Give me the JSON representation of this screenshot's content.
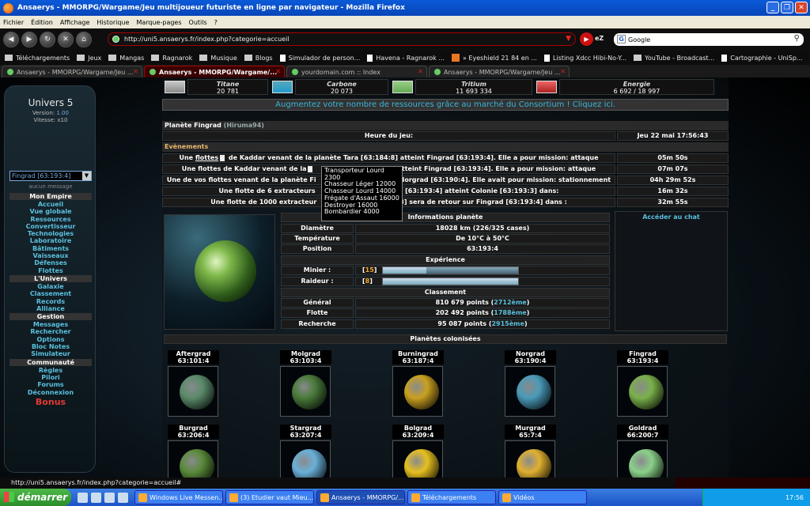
{
  "window": {
    "title": "Ansaerys - MMORPG/Wargame/Jeu multijoueur futuriste en ligne par navigateur - Mozilla Firefox"
  },
  "menu": [
    "Fichier",
    "Édition",
    "Affichage",
    "Historique",
    "Marque-pages",
    "Outils",
    "?"
  ],
  "url": "http://uni5.ansaerys.fr/index.php?categorie=accueil",
  "search": {
    "engine": "Google"
  },
  "bookmarks": [
    "Téléchargements",
    "Jeux",
    "Mangas",
    "Ragnarok",
    "Musique",
    "Blogs",
    "Simulador de person...",
    "Havena - Ragnarok ...",
    "» Eyeshield 21 84 en ...",
    "Listing Xdcc Hibi-No-Y...",
    "YouTube - Broadcast...",
    "Cartographie - UniSp..."
  ],
  "tabs": [
    "Ansaerys - MMORPG/Wargame/Jeu ...",
    "Ansaerys - MMORPG/Wargame/...",
    "yourdomain.com :: Index",
    "Ansaerys - MMORPG/Wargame/Jeu ..."
  ],
  "sidebar": {
    "title": "Univers 5",
    "version_label": "Version:",
    "version": "1.00",
    "vitesse_label": "Vitesse:",
    "vitesse": "x10",
    "planet": "Fingrad [63:193:4]",
    "no_message": "aucun message",
    "sections": [
      {
        "header": "Mon Empire",
        "items": [
          "Accueil",
          "Vue globale",
          "Ressources",
          "Convertisseur",
          "Technologies",
          "Laboratoire",
          "Bâtiments",
          "Vaisseaux",
          "Défenses",
          "Flottes"
        ]
      },
      {
        "header": "L'Univers",
        "items": [
          "Galaxie",
          "Classement",
          "Records",
          "Alliance"
        ]
      },
      {
        "header": "Gestion",
        "items": [
          "Messages",
          "Rechercher",
          "Options",
          "Bloc Notes",
          "Simulateur"
        ]
      },
      {
        "header": "Communauté",
        "items": [
          "Règles",
          "Pilori",
          "Forums",
          "Déconnexion"
        ]
      }
    ],
    "bonus": "Bonus"
  },
  "resources": [
    {
      "name": "Titane",
      "value": "20 781"
    },
    {
      "name": "Carbone",
      "value": "20 073"
    },
    {
      "name": "Tritium",
      "value": "11 693 334"
    },
    {
      "name": "Energie",
      "value": "6 692 / 18 997"
    }
  ],
  "promo": "Augmentez votre nombre de ressources grâce au marché du Consortium ! Cliquez ici.",
  "planet_header": {
    "name": "Planète Fingrad",
    "owner": "(Hiruma94)"
  },
  "time": {
    "label": "Heure du jeu:",
    "value": "Jeu 22 mai 17:56:43"
  },
  "events_label": "Evènements",
  "events": [
    {
      "pre": "Une ",
      "link": "flottes",
      "post": " de Kaddar  venant de la planète Tara [63:184:8] atteint Fingrad [63:193:4]. Elle a pour mission: attaque",
      "time": "05m 50s"
    },
    {
      "pre": "Une flottes de Kaddar  venant de la",
      "link": "",
      "post": "atteint Fingrad [63:193:4]. Elle a pour mission: attaque",
      "time": "07m 07s"
    },
    {
      "pre": "Une de vos flottes venant de la planète Fi",
      "link": "",
      "post": "Norgrad [63:190:4]. Elle avait pour mission: stationnement",
      "time": "04h 29m 52s"
    },
    {
      "pre": "Une flotte de 6 extracteurs",
      "link": "",
      "post": "d [63:193:4] atteint Colonie [63:193:3] dans:",
      "time": "16m 32s"
    },
    {
      "pre": "Une flotte de 1000 extracteur",
      "link": "",
      "post": "3] sera de retour sur Fingrad [63:193:4] dans :",
      "time": "32m 55s"
    }
  ],
  "tooltip": [
    "Transporteur Lourd",
    "2300",
    "Chasseur Léger 12000",
    "Chasseur Lourd 14000",
    "Frégate d'Assaut 16000",
    "Destroyer 16000",
    "Bombardier 4000"
  ],
  "info": {
    "header": "Informations planète",
    "rows": [
      {
        "label": "Diamètre",
        "value": "18028 km (226/325 cases)"
      },
      {
        "label": "Température",
        "value": "De 10°C à 50°C"
      },
      {
        "label": "Position",
        "value": "63:193:4"
      }
    ]
  },
  "experience": {
    "header": "Expérience",
    "rows": [
      {
        "label": "Minier :",
        "level": "15",
        "progress": 0.32
      },
      {
        "label": "Raideur :",
        "level": "8",
        "progress": 1.0
      }
    ]
  },
  "classement": {
    "header": "Classement",
    "rows": [
      {
        "label": "Général",
        "value": "810 679 points (",
        "rank": "2712ème",
        "close": ")"
      },
      {
        "label": "Flotte",
        "value": "202 492 points (",
        "rank": "1788ème",
        "close": ")"
      },
      {
        "label": "Recherche",
        "value": "95 087 points (",
        "rank": "2915ème",
        "close": ")"
      }
    ]
  },
  "chat": "Accéder au chat",
  "colonies_label": "Planètes colonisées",
  "colonies": [
    {
      "name": "Aftergrad",
      "coords": "63:101:4",
      "color": "#5a8a6a"
    },
    {
      "name": "Molgrad",
      "coords": "63:103:4",
      "color": "#4a7a3a"
    },
    {
      "name": "Burningrad",
      "coords": "63:187:4",
      "color": "#c9a020"
    },
    {
      "name": "Norgrad",
      "coords": "63:190:4",
      "color": "#4a9ab8"
    },
    {
      "name": "Fingrad",
      "coords": "63:193:4",
      "color": "#7ab04a"
    },
    {
      "name": "Burgrad",
      "coords": "63:206:4",
      "color": "#5a8a3a"
    },
    {
      "name": "Stargrad",
      "coords": "63:207:4",
      "color": "#6ab0d8"
    },
    {
      "name": "Bolgrad",
      "coords": "63:209:4",
      "color": "#e6c020"
    },
    {
      "name": "Murgrad",
      "coords": "65:7:4",
      "color": "#e0b030"
    },
    {
      "name": "Goldrad",
      "coords": "66:200:7",
      "color": "#8ad08a"
    }
  ],
  "status": "http://uni5.ansaerys.fr/index.php?categorie=accueil#",
  "taskbar": {
    "start": "démarrer",
    "items": [
      "Windows Live Messen...",
      "(3) Etudier vaut Mieu...",
      "Ansaerys - MMORPG/...",
      "Téléchargements",
      "Vidéos"
    ],
    "clock": "17:56"
  }
}
